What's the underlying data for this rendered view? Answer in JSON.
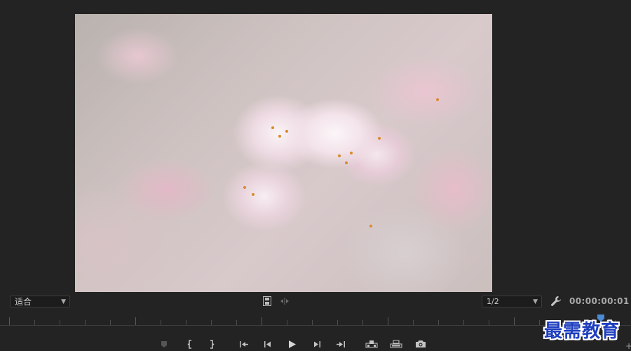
{
  "controls": {
    "zoom_level": "适合",
    "resolution": "1/2",
    "timecode": "00:00:00:01"
  },
  "icons": {
    "settings": "wrench-icon",
    "chevron": "chevron-down-icon"
  },
  "colors": {
    "background": "#232323",
    "playhead": "#4a8ad6",
    "watermark": "#1f3fbf"
  },
  "watermark": "最需教育"
}
